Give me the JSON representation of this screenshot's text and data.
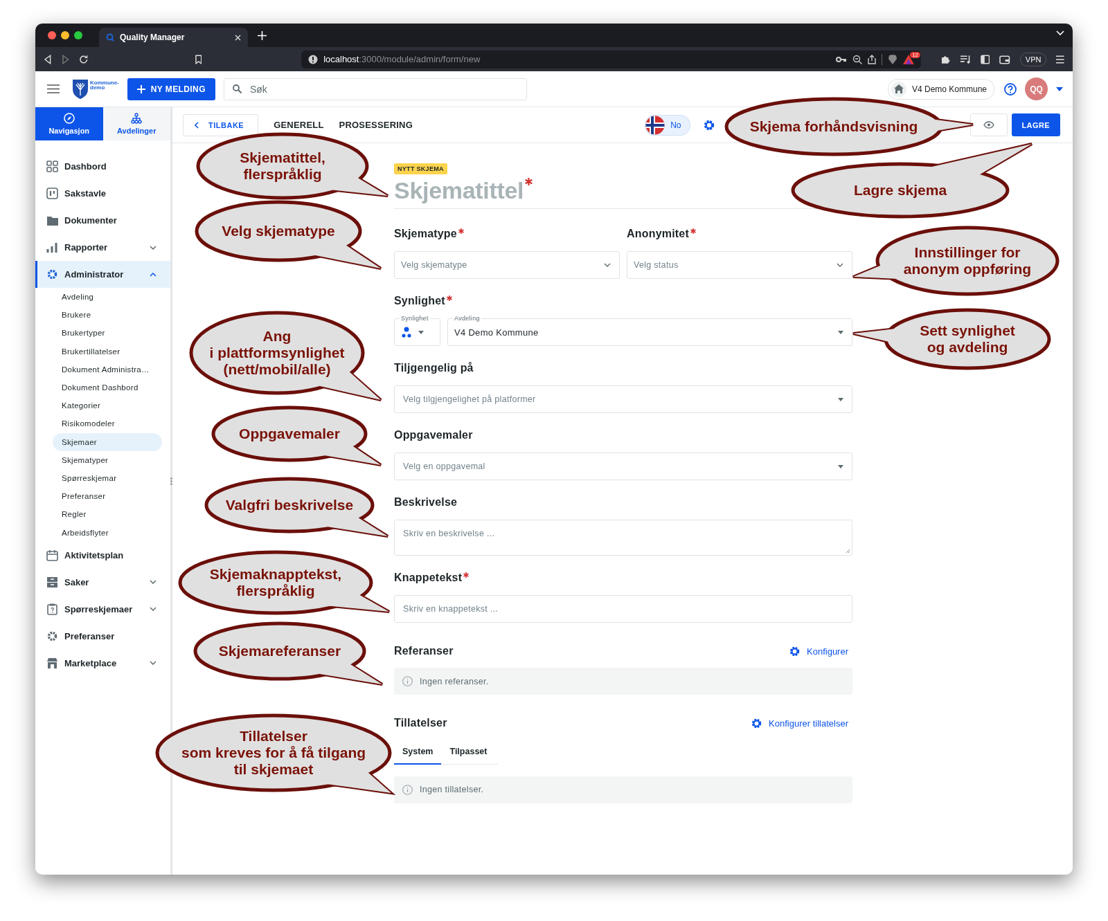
{
  "browser": {
    "tab_title": "Quality Manager",
    "url_host": "localhost",
    "url_rest": ":3000/module/admin/form/new",
    "notification_count": "12",
    "vpn": "VPN"
  },
  "header": {
    "logo_text": "Kommune-\ndemo",
    "new_button": "NY MELDING",
    "search_placeholder": "Søk",
    "organization": "V4 Demo Kommune",
    "avatar": "QQ"
  },
  "sidebar": {
    "tabs": [
      {
        "label": "Navigasjon",
        "selected": true
      },
      {
        "label": "Avdelinger",
        "selected": false
      }
    ],
    "items": [
      {
        "kind": "link",
        "label": "Dashbord",
        "selected": false
      },
      {
        "kind": "link",
        "label": "Sakstavle",
        "selected": false
      },
      {
        "kind": "link",
        "label": "Dokumenter",
        "selected": false
      },
      {
        "kind": "group",
        "label": "Rapporter",
        "selected": false,
        "expanded": false
      },
      {
        "kind": "group",
        "label": "Administrator",
        "selected": true,
        "expanded": true,
        "children": [
          {
            "label": "Avdeling",
            "selected": false
          },
          {
            "label": "Brukere",
            "selected": false
          },
          {
            "label": "Brukertyper",
            "selected": false
          },
          {
            "label": "Brukertillatelser",
            "selected": false
          },
          {
            "label": "Dokument Administra…",
            "selected": false
          },
          {
            "label": "Dokument Dashbord",
            "selected": false
          },
          {
            "label": "Kategorier",
            "selected": false
          },
          {
            "label": "Risikomodeler",
            "selected": false
          },
          {
            "label": "Skjemaer",
            "selected": true
          },
          {
            "label": "Skjematyper",
            "selected": false
          },
          {
            "label": "Spørreskjemar",
            "selected": false
          },
          {
            "label": "Preferanser",
            "selected": false
          },
          {
            "label": "Regler",
            "selected": false
          },
          {
            "label": "Arbeidsflyter",
            "selected": false
          }
        ]
      },
      {
        "kind": "link",
        "label": "Aktivitetsplan",
        "selected": false
      },
      {
        "kind": "group",
        "label": "Saker",
        "selected": false,
        "expanded": false
      },
      {
        "kind": "group",
        "label": "Spørreskjemaer",
        "selected": false,
        "expanded": false
      },
      {
        "kind": "link",
        "label": "Preferanser",
        "selected": false
      },
      {
        "kind": "group",
        "label": "Marketplace",
        "selected": false,
        "expanded": false
      }
    ]
  },
  "toolbar": {
    "back": "TILBAKE",
    "sections": [
      "GENERELL",
      "PROSESSERING"
    ],
    "language": "No",
    "save": "LAGRE"
  },
  "form": {
    "badge": "NYTT SKJEMA",
    "title_placeholder": "Skjematittel",
    "title_required": true,
    "fields": [
      {
        "kind": "pair",
        "columns": [
          {
            "label": "Skjematype",
            "required": true,
            "placeholder": "Velg skjematype"
          },
          {
            "label": "Anonymitet",
            "required": true,
            "placeholder": "Velg status"
          }
        ]
      },
      {
        "kind": "visibility",
        "label": "Synlighet",
        "required": true,
        "visibility_label": "Synlighet",
        "department_label": "Avdeling",
        "department_value": "V4 Demo Kommune"
      },
      {
        "kind": "select",
        "label": "Tiljgengelig på",
        "required": false,
        "placeholder": "Velg tilgjengelighet på platformer"
      },
      {
        "kind": "select",
        "label": "Oppgavemaler",
        "required": false,
        "placeholder": "Velg en oppgavemal"
      },
      {
        "kind": "textarea",
        "label": "Beskrivelse",
        "required": false,
        "placeholder": "Skriv en beskrivelse ..."
      },
      {
        "kind": "input",
        "label": "Knappetekst",
        "required": true,
        "placeholder": "Skriv en knappetekst ..."
      },
      {
        "kind": "list",
        "label": "Referanser",
        "action": "Konfigurer",
        "empty": "Ingen referanser."
      },
      {
        "kind": "tabbed_list",
        "label": "Tillatelser",
        "action": "Konfigurer tillatelser",
        "tabs": [
          {
            "label": "System",
            "selected": true
          },
          {
            "label": "Tilpasset",
            "selected": false
          }
        ],
        "empty": "Ingen tillatelser."
      }
    ]
  },
  "callouts": [
    {
      "text": "Skjematittel,\nflerspråklig"
    },
    {
      "text": "Velg skjematype"
    },
    {
      "text": "Ang\ni plattformsynlighet\n(nett/mobil/alle)"
    },
    {
      "text": "Oppgavemaler"
    },
    {
      "text": "Valgfri beskrivelse"
    },
    {
      "text": "Skjemaknapptekst,\nflerspråklig"
    },
    {
      "text": "Skjemareferanser"
    },
    {
      "text": "Tillatelser\nsom kreves for å få tilgang\ntil skjemaet"
    },
    {
      "text": "Skjema forhåndsvisning"
    },
    {
      "text": "Lagre skjema"
    },
    {
      "text": "Innstillinger for\nanonym oppføring"
    },
    {
      "text": "Sett synlighet\nog avdeling"
    }
  ]
}
